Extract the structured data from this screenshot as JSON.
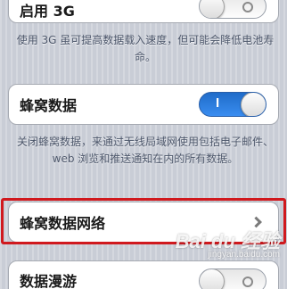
{
  "rows": {
    "enable_3g": {
      "label": "启用 3G",
      "toggle_state": "off"
    },
    "cellular_data": {
      "label": "蜂窝数据",
      "toggle_state": "on",
      "toggle_on_text": "I"
    },
    "cellular_network": {
      "label": "蜂窝数据网络"
    },
    "data_roaming": {
      "label": "数据漫游",
      "toggle_state": "off"
    }
  },
  "notes": {
    "enable_3g_note": "使用 3G 虽可提高数据载入速度，但可能会降低电池寿命。",
    "cellular_data_note": "关闭蜂窝数据，来通过无线局域网使用包括电子邮件、web 浏览和推送通知在内的所有数据。"
  },
  "watermark": {
    "logo": "Bai du 经验",
    "url": "jingyan.baidu.com"
  },
  "colors": {
    "toggle_on": "#2f7fe0",
    "highlight": "#d0191e",
    "background": "#c9cdd6"
  }
}
